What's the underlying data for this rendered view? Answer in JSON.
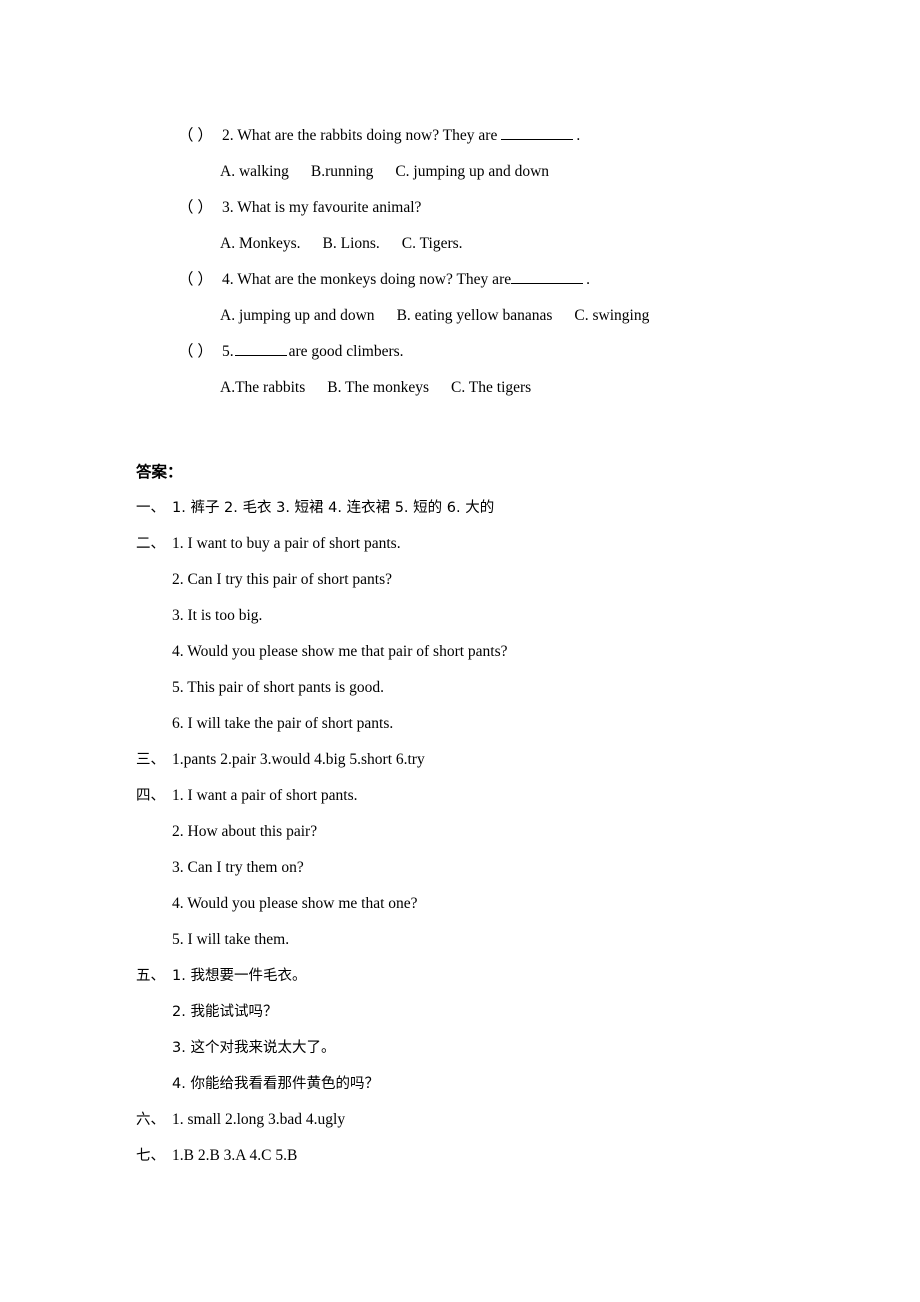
{
  "document": {
    "type": "worksheet-answer-key",
    "language": "zh-en"
  },
  "questions": {
    "items": [
      {
        "brackets": "（  ）",
        "text": "2. What are the rabbits doing now? They are",
        "text_after": ".",
        "blank": "long",
        "options": [
          "A. walking",
          "B.running",
          "C. jumping up and down"
        ]
      },
      {
        "brackets": "（  ）",
        "text": "3. What is my favourite animal?",
        "text_after": "",
        "blank": "none",
        "options": [
          "A. Monkeys.",
          "B. Lions.",
          "C. Tigers."
        ]
      },
      {
        "brackets": "（  ）",
        "text": "4. What are the monkeys doing now? They are",
        "text_after": ".",
        "blank": "long-tight",
        "options": [
          "A. jumping up and down",
          "B. eating yellow bananas",
          "C. swinging"
        ]
      },
      {
        "brackets": "（  ）",
        "text_before": "5.",
        "text": "are good climbers.",
        "text_after": "",
        "blank": "leading",
        "options": [
          "A.The rabbits",
          "B. The monkeys",
          "C. The tigers"
        ]
      }
    ]
  },
  "answers": {
    "title": "答案：",
    "sections": [
      {
        "marker": "一、",
        "lines": [
          "1. 裤子  2. 毛衣  3. 短裙  4. 连衣裙  5. 短的  6. 大的"
        ],
        "script": "cn"
      },
      {
        "marker": "二、",
        "lines": [
          "1. I want to buy a pair of short pants.",
          "2. Can I try this pair of short pants?",
          "3. It is too big.",
          "4. Would you please show me that pair of short pants?",
          "5. This pair of short pants is good.",
          "6. I will take the pair of short pants."
        ],
        "script": "en"
      },
      {
        "marker": "三、",
        "lines": [
          "1.pants     2.pair       3.would     4.big      5.short     6.try"
        ],
        "script": "en"
      },
      {
        "marker": "四、",
        "lines": [
          "1. I want a pair of short pants.",
          "2. How about this pair?",
          "3. Can I try them on?",
          "4. Would you please show me that one?",
          "5. I will take them."
        ],
        "script": "en"
      },
      {
        "marker": "五、",
        "lines": [
          "1. 我想要一件毛衣。",
          "2. 我能试试吗？",
          "3. 这个对我来说太大了。",
          "4. 你能给我看看那件黄色的吗？"
        ],
        "script": "cn"
      },
      {
        "marker": "六、",
        "lines": [
          "1. small    2.long      3.bad     4.ugly"
        ],
        "script": "en"
      },
      {
        "marker": "七、",
        "lines": [
          "1.B   2.B   3.A   4.C   5.B"
        ],
        "script": "en"
      }
    ]
  },
  "colors": {
    "text": "#000000",
    "background": "#ffffff"
  }
}
